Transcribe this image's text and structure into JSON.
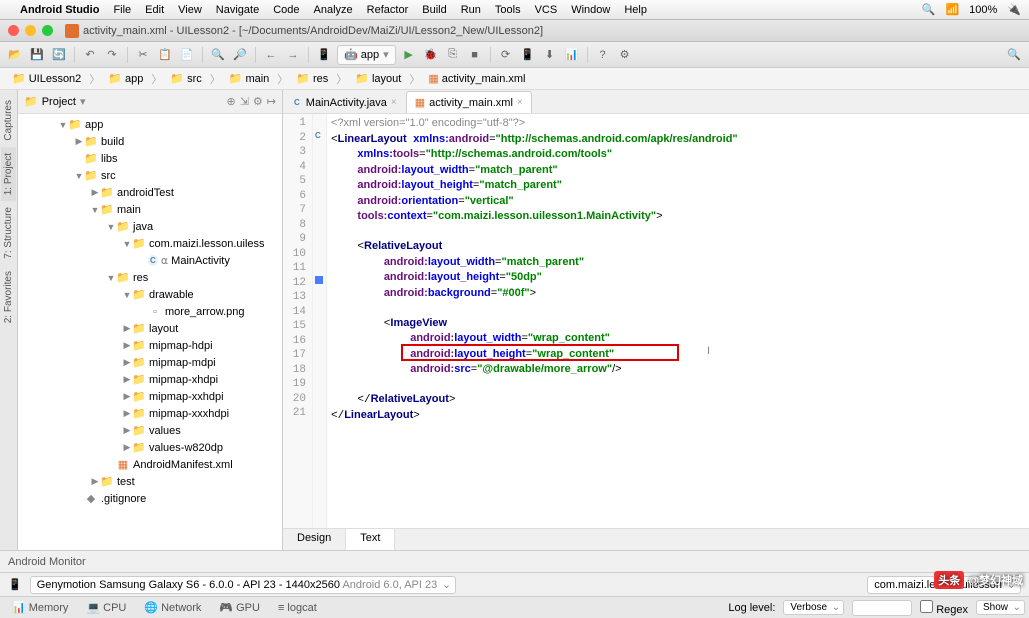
{
  "menubar": {
    "app": "Android Studio",
    "items": [
      "File",
      "Edit",
      "View",
      "Navigate",
      "Code",
      "Analyze",
      "Refactor",
      "Build",
      "Run",
      "Tools",
      "VCS",
      "Window",
      "Help"
    ],
    "battery": "100%"
  },
  "window_title": "activity_main.xml - UILesson2 - [~/Documents/AndroidDev/MaiZi/UI/Lesson2_New/UILesson2]",
  "run_config": "app",
  "breadcrumbs": [
    "UILesson2",
    "app",
    "src",
    "main",
    "res",
    "layout",
    "activity_main.xml"
  ],
  "side_tabs": [
    "Captures",
    "1: Project",
    "7: Structure",
    "2: Favorites"
  ],
  "panel_title": "Project",
  "tree": {
    "app": "app",
    "build": "build",
    "libs": "libs",
    "src": "src",
    "androidTest": "androidTest",
    "main": "main",
    "java": "java",
    "pkg": "com.maizi.lesson.uiless",
    "main_activity": "MainActivity",
    "res": "res",
    "drawable": "drawable",
    "more_arrow": "more_arrow.png",
    "layout": "layout",
    "mipmap_hdpi": "mipmap-hdpi",
    "mipmap_mdpi": "mipmap-mdpi",
    "mipmap_xhdpi": "mipmap-xhdpi",
    "mipmap_xxhdpi": "mipmap-xxhdpi",
    "mipmap_xxxhdpi": "mipmap-xxxhdpi",
    "values": "values",
    "values_w820": "values-w820dp",
    "manifest": "AndroidManifest.xml",
    "test": "test",
    "gitignore": ".gitignore"
  },
  "tabs": {
    "main_activity": "MainActivity.java",
    "activity_main": "activity_main.xml"
  },
  "code": {
    "l1": "<?xml version=\"1.0\" encoding=\"utf-8\"?>",
    "l2a": "LinearLayout",
    "l2b": "xmlns:",
    "l2c": "android",
    "l2d": "=",
    "l2e": "\"http://schemas.android.com/apk/res/android\"",
    "l3a": "xmlns:",
    "l3b": "tools",
    "l3c": "=",
    "l3d": "\"http://schemas.android.com/tools\"",
    "l4a": "android:",
    "l4b": "layout_width",
    "l4c": "=",
    "l4d": "\"match_parent\"",
    "l5a": "android:",
    "l5b": "layout_height",
    "l5c": "=",
    "l5d": "\"match_parent\"",
    "l6a": "android:",
    "l6b": "orientation",
    "l6c": "=",
    "l6d": "\"vertical\"",
    "l7a": "tools:",
    "l7b": "context",
    "l7c": "=",
    "l7d": "\"com.maizi.lesson.uilesson1.MainActivity\"",
    "l7e": ">",
    "l9": "RelativeLayout",
    "l10d": "\"match_parent\"",
    "l11d": "\"50dp\"",
    "l12a": "android:",
    "l12b": "background",
    "l12d": "\"#00f\"",
    "l12e": ">",
    "l14": "ImageView",
    "l15d": "\"wrap_content\"",
    "l16d": "\"wrap_content\"",
    "l17a": "android:",
    "l17b": "src",
    "l17d": "\"@drawable/more_arrow\"",
    "l17e": "/>",
    "l19": "RelativeLayout",
    "l20": "LinearLayout"
  },
  "designer_tabs": {
    "design": "Design",
    "text": "Text"
  },
  "status": "Android Monitor",
  "device": {
    "name": "Genymotion Samsung Galaxy S6 - 6.0.0 - API 23 - 1440x2560",
    "api": "Android 6.0, API 23"
  },
  "process": "com.maizi.lesson.uilesson",
  "bottom_tabs": [
    "Memory",
    "CPU",
    "Network",
    "GPU",
    "logcat"
  ],
  "log_level_label": "Log level:",
  "log_level": "Verbose",
  "regex": "Regex",
  "show": "Show",
  "watermark": {
    "brand": "头条",
    "user": "@梦幻神域"
  }
}
